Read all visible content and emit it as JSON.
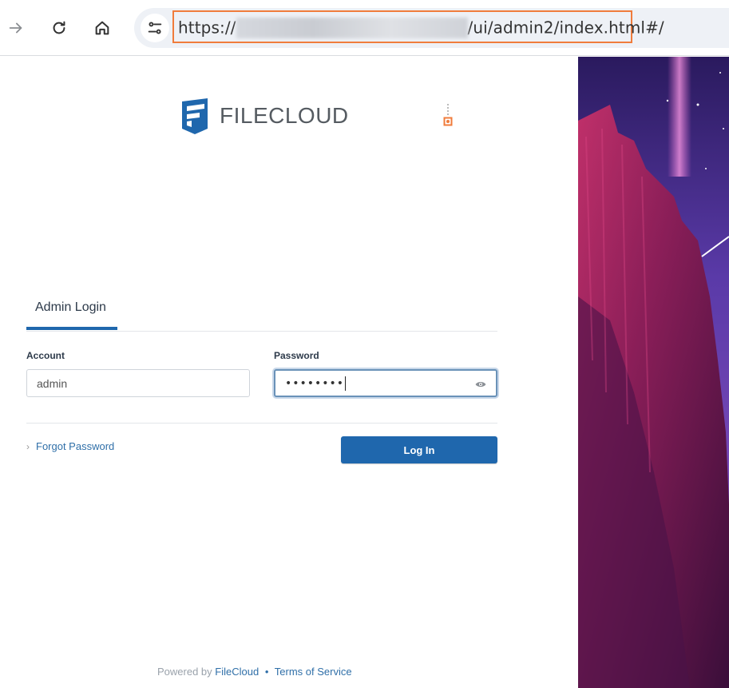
{
  "browser": {
    "url_prefix": "https://",
    "url_path": "/ui/admin2/index.html#/",
    "icons": [
      "forward-icon",
      "reload-icon",
      "home-icon",
      "site-info-icon"
    ],
    "highlight_color": "#f07c3c"
  },
  "brand": {
    "logo_text_a": "FILE",
    "logo_text_b": "CLOUD",
    "logo_color": "#1f67ad"
  },
  "login": {
    "tab_label": "Admin Login",
    "account_label": "Account",
    "account_value": "admin",
    "password_label": "Password",
    "password_mask": "••••••••",
    "forgot_label": "Forgot Password",
    "login_button": "Log In",
    "accent_color": "#1f67ad"
  },
  "footer": {
    "powered_by": "Powered by",
    "brand_link": "FileCloud",
    "separator": "•",
    "terms_link": "Terms of Service"
  }
}
